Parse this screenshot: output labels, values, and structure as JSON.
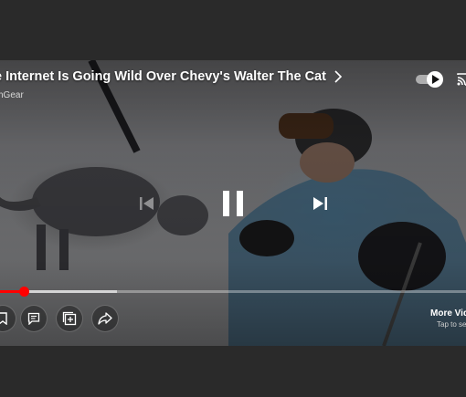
{
  "video": {
    "title": "e Internet Is Going Wild Over Chevy's Walter The Cat",
    "channel": "hGear",
    "autoplay_on": true
  },
  "progress": {
    "played_fraction": 0.05,
    "buffered_fraction": 0.25
  },
  "more_videos": {
    "label": "More Vid",
    "sublabel": "Tap to se"
  },
  "icons": {
    "title_chevron": "chevron-right-icon",
    "autoplay": "autoplay-toggle-icon",
    "cast": "cast-icon",
    "previous": "skip-previous-icon",
    "pause": "pause-icon",
    "next": "skip-next-icon",
    "save": "save-icon",
    "comment": "comment-icon",
    "add": "add-to-playlist-icon",
    "share": "share-icon"
  },
  "colors": {
    "progress_played": "#ff0000",
    "background": "#2a2a2a"
  }
}
